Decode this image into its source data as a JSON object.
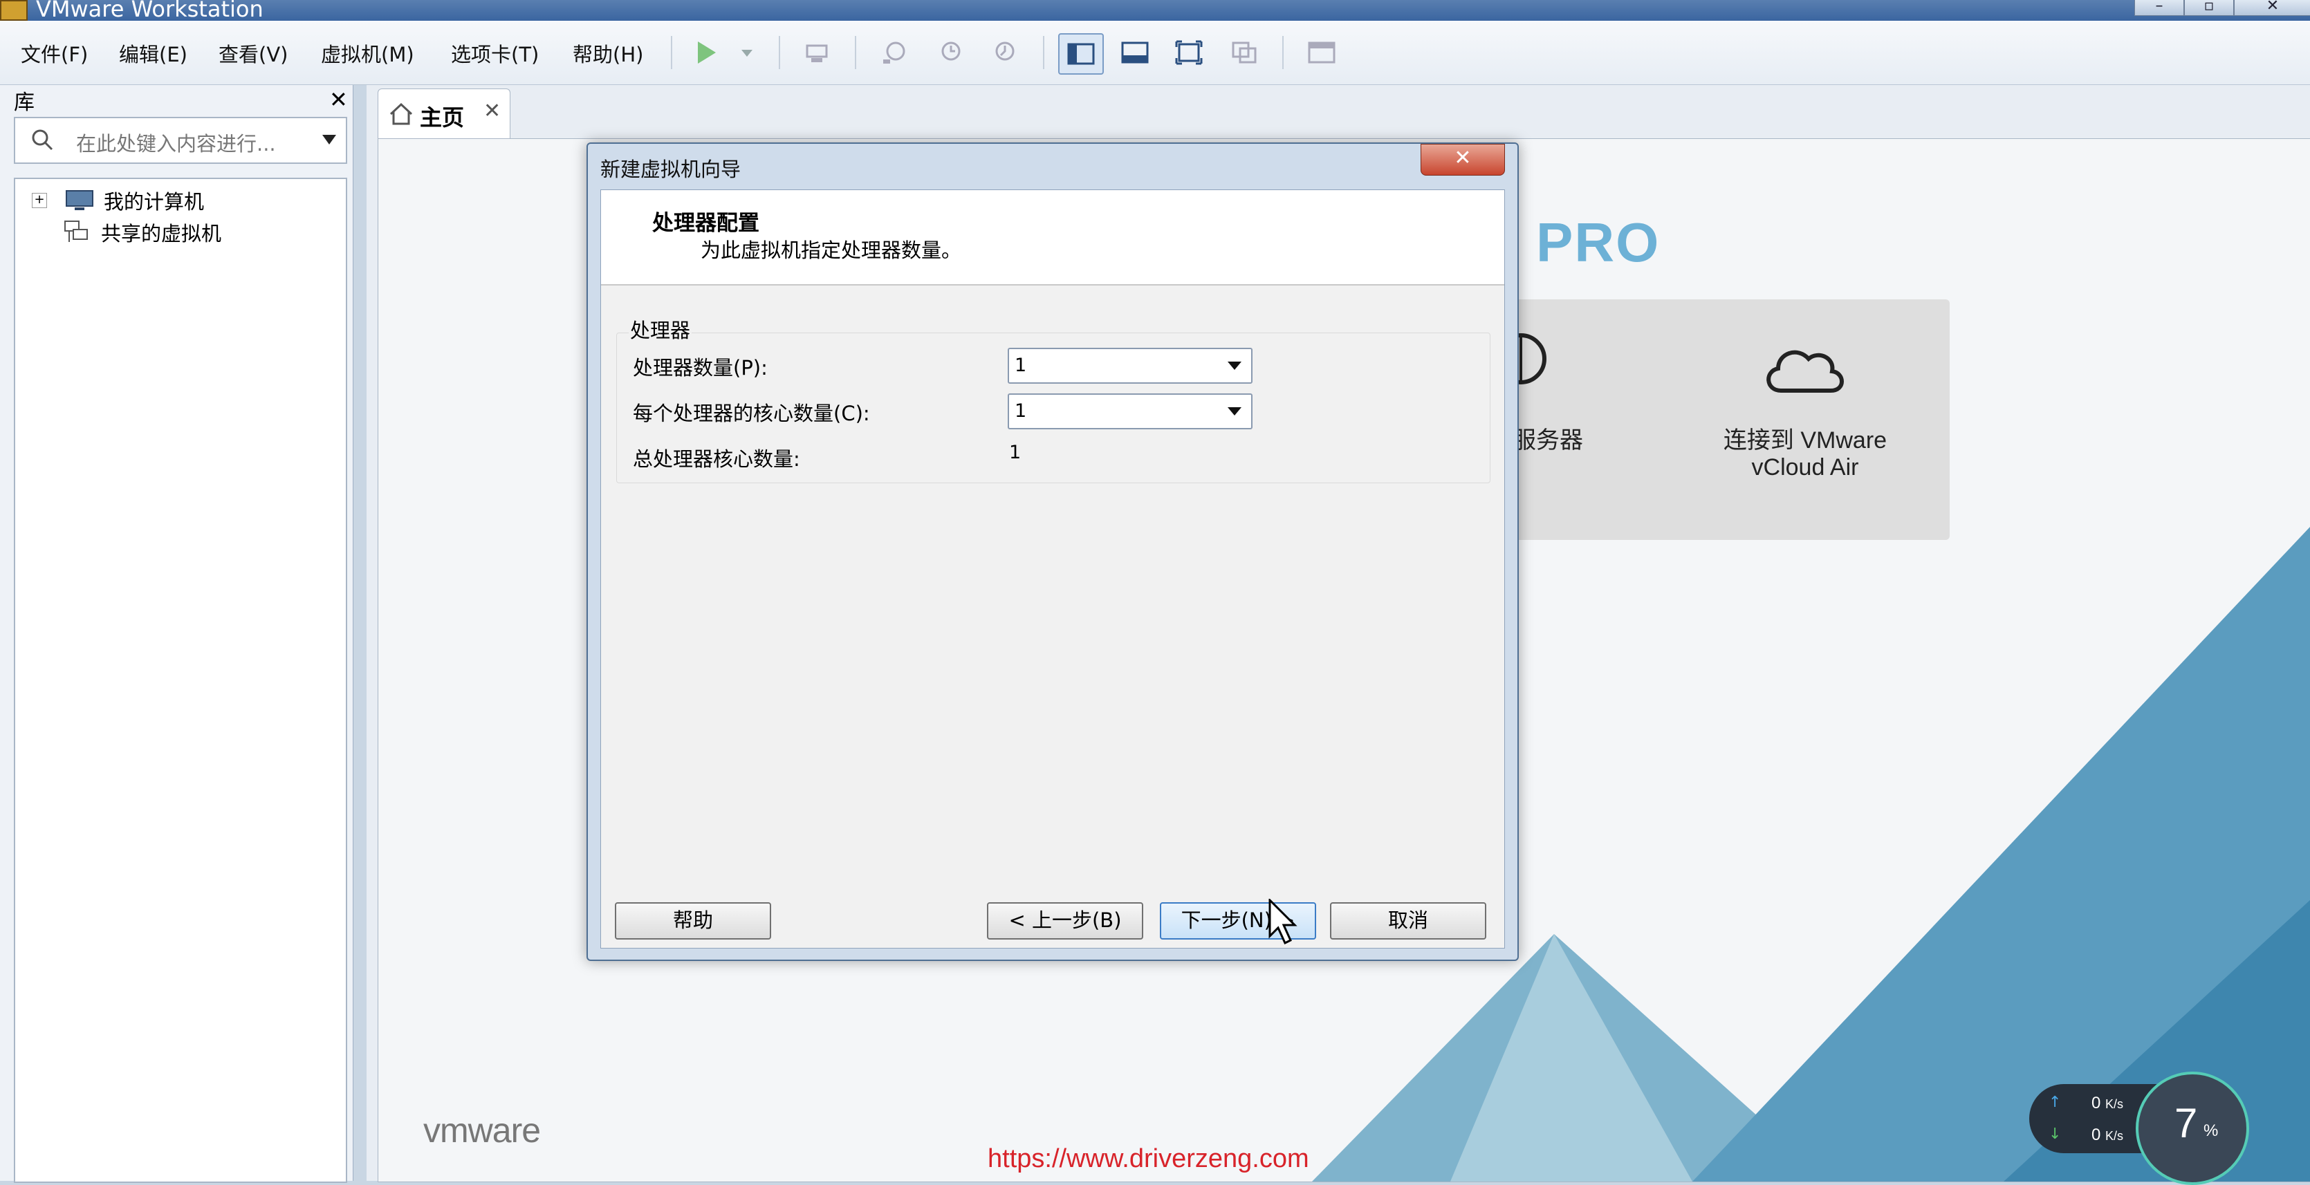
{
  "window": {
    "title": "VMware Workstation"
  },
  "menu": [
    "文件(F)",
    "编辑(E)",
    "查看(V)",
    "虚拟机(M)",
    "选项卡(T)",
    "帮助(H)"
  ],
  "library": {
    "header": "库",
    "search_placeholder": "在此处键入内容进行...",
    "items": [
      "我的计算机",
      "共享的虚拟机"
    ]
  },
  "tabs": [
    {
      "label": "主页"
    }
  ],
  "home": {
    "product_text": "PRO",
    "cards": [
      {
        "label_line1": "服务器",
        "icon": "server-icon"
      },
      {
        "label_line1": "连接到 VMware",
        "label_line2": "vCloud Air",
        "icon": "cloud-icon"
      }
    ],
    "logo": "vmware",
    "watermark": "https://www.driverzeng.com"
  },
  "net": {
    "up": "0",
    "down": "0",
    "unit": "K/s"
  },
  "cpu": {
    "value": "7",
    "unit": "%"
  },
  "dialog": {
    "title": "新建虚拟机向导",
    "heading": "处理器配置",
    "subheading": "为此虚拟机指定处理器数量。",
    "group": "处理器",
    "fields": {
      "processors_label": "处理器数量(P):",
      "processors_value": "1",
      "cores_label": "每个处理器的核心数量(C):",
      "cores_value": "1",
      "total_label": "总处理器核心数量:",
      "total_value": "1"
    },
    "buttons": {
      "help": "帮助",
      "back": "< 上一步(B)",
      "next": "下一步(N) >",
      "cancel": "取消"
    }
  },
  "colors": {
    "accent": "#3b7cc6",
    "pro": "#6db1d6",
    "watermark": "#d8232a"
  }
}
